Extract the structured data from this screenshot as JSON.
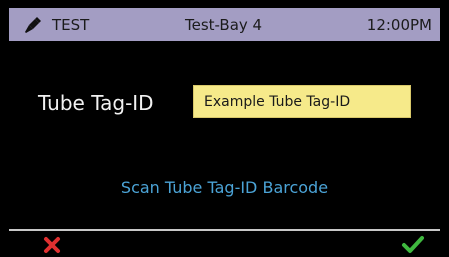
{
  "header": {
    "mode_icon": "pen-icon",
    "mode_label": "TEST",
    "location": "Test-Bay 4",
    "time": "12:00PM",
    "background_color": "#a39dc3"
  },
  "form": {
    "tag_id_label": "Tube Tag-ID",
    "tag_id_value": "Example Tube Tag-ID",
    "input_color": "#f6ea8a"
  },
  "scan": {
    "label": "Scan Tube Tag-ID Barcode",
    "color": "#4ba3d6"
  },
  "footer": {
    "cancel_icon": "close-icon",
    "cancel_color": "#e03030",
    "confirm_icon": "checkmark-icon",
    "confirm_color": "#3fb83f"
  }
}
